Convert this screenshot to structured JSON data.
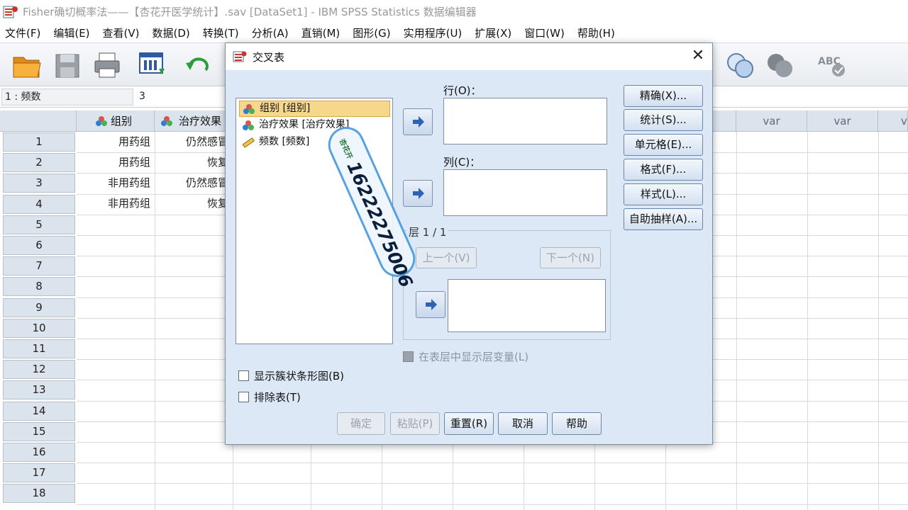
{
  "window": {
    "title": "Fisher确切概率法——【杏花开医学统计】.sav [DataSet1] - IBM SPSS Statistics 数据编辑器"
  },
  "menu": [
    "文件(F)",
    "编辑(E)",
    "查看(V)",
    "数据(D)",
    "转换(T)",
    "分析(A)",
    "直销(M)",
    "图形(G)",
    "实用程序(U)",
    "扩展(X)",
    "窗口(W)",
    "帮助(H)"
  ],
  "toolbar": {
    "buttons": [
      "open-folder-icon",
      "save-icon",
      "print-icon",
      "dialog-recall-icon",
      "undo-icon",
      "circles-icon",
      "value-labels-icon",
      "spellcheck-icon"
    ]
  },
  "cell_editor": {
    "reference": "1 : 频数",
    "value": "3"
  },
  "grid": {
    "columns": [
      "组别",
      "治疗效果",
      "var",
      "var"
    ],
    "row_numbers": [
      "1",
      "2",
      "3",
      "4",
      "5",
      "6",
      "7",
      "8",
      "9",
      "10",
      "11",
      "12",
      "13",
      "14",
      "15",
      "16",
      "17",
      "18"
    ],
    "rows": [
      [
        "用药组",
        "仍然感冒"
      ],
      [
        "用药组",
        "恢复"
      ],
      [
        "非用药组",
        "仍然感冒"
      ],
      [
        "非用药组",
        "恢复"
      ]
    ]
  },
  "dialog": {
    "title": "交叉表",
    "close": "✕",
    "variables": [
      {
        "label": "组别 [组别]",
        "icon": "nominal-variable-icon",
        "selected": true
      },
      {
        "label": "治疗效果 [治疗效果]",
        "icon": "nominal-variable-icon",
        "selected": false
      },
      {
        "label": "频数 [频数]",
        "icon": "scale-variable-icon",
        "selected": false
      }
    ],
    "rows_label": "行(O)：",
    "columns_label": "列(C)：",
    "layer_label": "层 1 / 1",
    "prev_button": "上一个(V)",
    "next_button": "下一个(N)",
    "show_layer_vars": "在表层中显示层变量(L)",
    "side_buttons": [
      "精确(X)...",
      "统计(S)...",
      "单元格(E)...",
      "格式(F)...",
      "样式(L)...",
      "自助抽样(A)..."
    ],
    "checkboxes": [
      "显示簇状条形图(B)",
      "排除表(T)"
    ],
    "footer_buttons": [
      {
        "label": "确定",
        "enabled": false
      },
      {
        "label": "粘贴(P)",
        "enabled": false
      },
      {
        "label": "重置(R)",
        "enabled": true
      },
      {
        "label": "取消",
        "enabled": true
      },
      {
        "label": "帮助",
        "enabled": true
      }
    ]
  },
  "watermark": {
    "phone": "16222275006",
    "text": "杏花开"
  }
}
